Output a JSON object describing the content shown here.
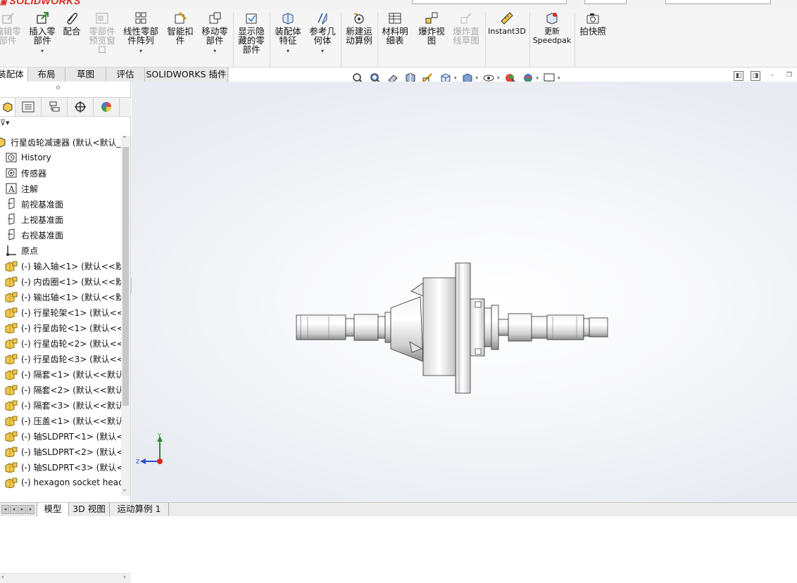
{
  "app": {
    "logo": "SOLIDWORKS"
  },
  "ribbon": {
    "buttons": [
      {
        "label": "编辑零\n部件",
        "disabled": true
      },
      {
        "label": "插入零\n部件"
      },
      {
        "label": "配合"
      },
      {
        "label": "零部件\n预览窗\n口",
        "disabled": true
      },
      {
        "label": "线性零部\n件阵列"
      },
      {
        "label": "智能扣\n件"
      },
      {
        "label": "移动零\n部件"
      },
      {
        "label": "显示隐\n藏的零\n部件"
      },
      {
        "label": "装配体\n特征"
      },
      {
        "label": "参考几\n何体"
      },
      {
        "label": "新建运\n动算例"
      },
      {
        "label": "材料明\n细表"
      },
      {
        "label": "爆炸视\n图"
      },
      {
        "label": "爆炸直\n线草图",
        "disabled": true
      },
      {
        "label": "Instant3D"
      },
      {
        "label": "更新\nSpeedpak"
      },
      {
        "label": "拍快照"
      }
    ]
  },
  "cmd_tabs": [
    "装配体",
    "布局",
    "草图",
    "评估",
    "SOLIDWORKS 插件"
  ],
  "feature_tree": {
    "filter_icon": "filter-icon",
    "root": "行星齿轮减速器  (默认<默认_显",
    "items": [
      {
        "label": "History",
        "icon": "history-icon"
      },
      {
        "label": "传感器",
        "icon": "sensor-icon"
      },
      {
        "label": "注解",
        "icon": "annotation-icon"
      },
      {
        "label": "前视基准面",
        "icon": "plane-icon"
      },
      {
        "label": "上视基准面",
        "icon": "plane-icon"
      },
      {
        "label": "右视基准面",
        "icon": "plane-icon"
      },
      {
        "label": "原点",
        "icon": "origin-icon"
      },
      {
        "label": "(-) 输入轴<1> (默认<<默",
        "icon": "part-icon"
      },
      {
        "label": "(-) 内齿圈<1> (默认<<默",
        "icon": "part-icon"
      },
      {
        "label": "(-) 输出轴<1> (默认<<默",
        "icon": "part-icon"
      },
      {
        "label": "(-) 行星轮架<1> (默认<<",
        "icon": "part-icon"
      },
      {
        "label": "(-) 行星齿轮<1> (默认<<",
        "icon": "part-icon"
      },
      {
        "label": "(-) 行星齿轮<2> (默认<<",
        "icon": "part-icon"
      },
      {
        "label": "(-) 行星齿轮<3> (默认<<",
        "icon": "part-icon"
      },
      {
        "label": "(-) 隔套<1> (默认<<默认",
        "icon": "part-icon"
      },
      {
        "label": "(-) 隔套<2> (默认<<默认",
        "icon": "part-icon"
      },
      {
        "label": "(-) 隔套<3> (默认<<默认",
        "icon": "part-icon"
      },
      {
        "label": "(-) 压盖<1> (默认<<默认",
        "icon": "part-icon"
      },
      {
        "label": "(-) 轴SLDPRT<1> (默认<",
        "icon": "part-icon"
      },
      {
        "label": "(-) 轴SLDPRT<2> (默认<",
        "icon": "part-icon"
      },
      {
        "label": "(-) 轴SLDPRT<3> (默认<",
        "icon": "part-icon"
      },
      {
        "label": "(-) hexagon socket head",
        "icon": "part-icon"
      }
    ]
  },
  "triad": {
    "y": "Y",
    "z": "Z"
  },
  "bottom_tabs": [
    "模型",
    "3D 视图",
    "运动算例 1"
  ]
}
